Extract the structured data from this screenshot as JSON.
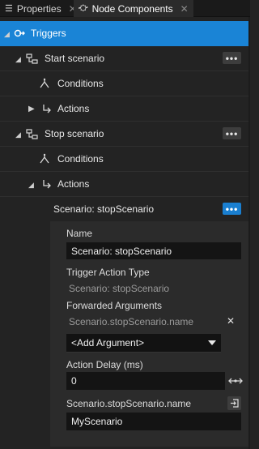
{
  "tabs": [
    {
      "label": "Properties",
      "close": "✕"
    },
    {
      "label": "Node Components",
      "close": "✕"
    }
  ],
  "tree": {
    "root": {
      "label": "Triggers"
    },
    "start": {
      "label": "Start scenario",
      "more": "•••"
    },
    "start_conditions": {
      "label": "Conditions"
    },
    "start_actions": {
      "label": "Actions"
    },
    "stop": {
      "label": "Stop scenario",
      "more": "•••"
    },
    "stop_conditions": {
      "label": "Conditions"
    },
    "stop_actions": {
      "label": "Actions"
    },
    "action": {
      "label": "Scenario: stopScenario",
      "more": "•••"
    }
  },
  "panel": {
    "name_label": "Name",
    "name_value": "Scenario: stopScenario",
    "type_label": "Trigger Action Type",
    "type_value": "Scenario: stopScenario",
    "fwd_label": "Forwarded Arguments",
    "fwd_arg": "Scenario.stopScenario.name",
    "remove_icon": "✕",
    "add_argument": "<Add Argument>",
    "delay_label": "Action Delay (ms)",
    "delay_value": "0",
    "arg_label": "Scenario.stopScenario.name",
    "arg_value": "MyScenario"
  },
  "colors": {
    "selected": "#1a84d6",
    "background": "#232323",
    "panel": "#2b2b2b",
    "field": "#141414"
  }
}
